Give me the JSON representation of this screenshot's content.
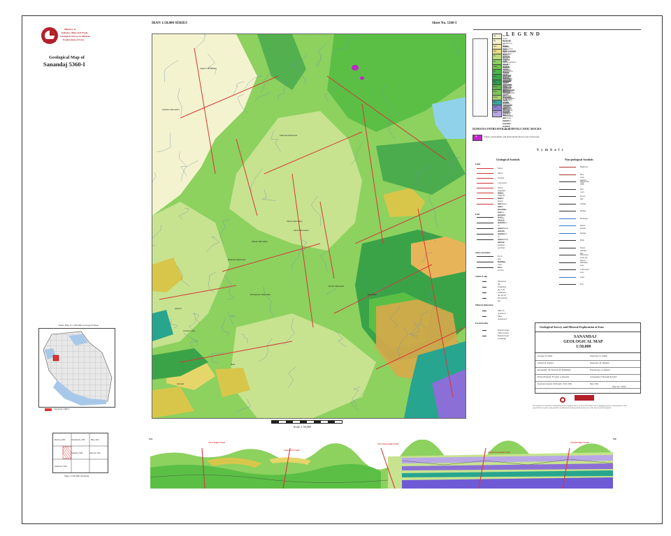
{
  "header": {
    "series": "IRAN 1:50,000 SERIES",
    "sheet_no": "Sheet No. 5360-I"
  },
  "logo": {
    "line1": "Ministry of",
    "line2": "Industry, Mine and Trade",
    "line3": "Geological Survey & Mineral",
    "line4": "Explorations of Iran"
  },
  "map_title": {
    "line1": "Geological Map of",
    "line2": "Sanandaj 5360-I"
  },
  "index_map": {
    "title": "Index Map of 1:250,000 Geological Sheet",
    "legend_label": "Sanandaj 5360-I"
  },
  "sheet_index": {
    "cells": [
      "Marivan_5260",
      "Divandarreh_5360",
      "Bijar_5461",
      "Sanandaj_5360",
      "Kamyaran_5359",
      "Ghorveh_5359"
    ],
    "caption": "Sheet 1:250,000 Sanandaj"
  },
  "scale": {
    "label": "Scale: 1:50,000"
  },
  "legend": {
    "title": "L E G E N D",
    "units": [
      {
        "code": "Qa",
        "color": "#f3f3d8",
        "label": "Recent loose alluvium in braided rivers"
      },
      {
        "code": "Qt",
        "color": "#f5f0c8",
        "label": "Rigid/dip, rounded or slightly transported unconsolidated deposits covering bedrock"
      },
      {
        "code": "Qt2",
        "color": "#f0e8a8",
        "label": "Older and high level terrace"
      },
      {
        "code": "Qt1",
        "color": "#e8dc80",
        "label": "Older and high level river terraces, remnant unconsolidated clastic deposits"
      },
      {
        "code": "Kl",
        "color": "#b9dd7e",
        "label": "Grey to brown well rounded bedded limestone in lower parts and massive fine grain"
      },
      {
        "code": "Ks",
        "color": "#8fd260",
        "label": "Light brown medium to thick bedded sandstone, calcareous sandstone"
      },
      {
        "code": "Ksh",
        "color": "#6ec645",
        "label": "Grey to cream thin to thick bedded limestone, sandy limestone with grey shale"
      },
      {
        "code": "Kv",
        "color": "#4cb84a",
        "label": "Alternation of dark grey thin to medium bedded calcareous sandstone and shale"
      },
      {
        "code": "Kd",
        "color": "#39a848",
        "label": "Greenish grey thin bedded calcareous shale with intercalations of sandy limestone"
      },
      {
        "code": "Kg",
        "color": "#2f9a4a",
        "label": "Greenish grey, dark, calcareous, siltstone with intercalations of conglomerate"
      },
      {
        "code": "Kvs",
        "color": "#5cb54a",
        "label": "Dark green volcanic rocks containing basalt, andesite, volcanic breccia and tuff"
      },
      {
        "code": "Km",
        "color": "#7cc655",
        "label": "Alternation of dark grey thin to medium bedded calcareous shale"
      },
      {
        "code": "Klm",
        "color": "#a6d16d",
        "label": "Dark grey thick bedded calcareous sandstone, siltstone and slate"
      },
      {
        "code": "Kul",
        "color": "#3aa7a0",
        "label": "Lower Cretaceous sandstone (Jurassic to Lower Cretaceous)"
      },
      {
        "code": "TRl",
        "color": "#8a7fd0",
        "label": "Triassic: limestone, sandstone and limestone (dolomite to green marble)"
      },
      {
        "code": "TRd",
        "color": "#b9a8e6",
        "label": "Triassic limestone and marble (dolomite to green marble)"
      }
    ],
    "intrusive_title": "IGNEOUS INTRUSIVE & SUBVOLCANIC ROCKS",
    "intrusive": {
      "code": "gb",
      "color": "#c026c6",
      "label": "Gabbro, monzogabbro and monzodiorite (Post Lower Cretaceous)"
    }
  },
  "symbols": {
    "title": "S y m b o l s",
    "geo_title": "Geological Symbols",
    "nongeo_title": "Non-geological Symbols",
    "geo": [
      {
        "label": "Major",
        "color": "#cc3333"
      },
      {
        "label": "Minor",
        "color": "#cc3333"
      },
      {
        "label": "Normal",
        "color": "#cc3333"
      },
      {
        "label": "Concealed",
        "color": "#cc3333"
      },
      {
        "label": "Strike slip(right lateral)",
        "color": "#cc3333"
      },
      {
        "label": "Strike slip(Left lateral)",
        "color": "#cc3333"
      },
      {
        "label": "Right lateral movement fault (showing in cross section)",
        "color": "#cc3333"
      },
      {
        "label": "Left lateral movement fault (showing in cross section)",
        "color": "#cc3333"
      },
      {
        "label": "Axial trace of anticline",
        "color": "#333333"
      },
      {
        "label": "Axial trace of approximate anticline",
        "color": "#333333"
      },
      {
        "label": "Axial trace of syncline",
        "color": "#333333"
      },
      {
        "label": "Axial trace of approximate syncline",
        "color": "#333333"
      },
      {
        "label": "Axial trace of plunged syncline",
        "color": "#333333"
      },
      {
        "label": "Rock unit boundary",
        "color": "#333333"
      },
      {
        "label": "Bedding form line",
        "color": "#333333"
      },
      {
        "label": "Cross section",
        "color": "#333333"
      },
      {
        "label": "Measured dip",
        "color": "#333333"
      },
      {
        "label": "Estimated dip 5-29",
        "color": "#333333"
      },
      {
        "label": "Estimated dip 30-59",
        "color": "#333333"
      },
      {
        "label": "Overturned dip",
        "color": "#333333"
      },
      {
        "label": "Mine in operation",
        "color": "#333333"
      },
      {
        "label": "Mine abandoned",
        "color": "#333333"
      },
      {
        "label": "Paleontologic (thin section)",
        "color": "#333333"
      },
      {
        "label": "Paleontologic (washing)",
        "color": "#333333"
      }
    ],
    "nongeo": [
      {
        "label": "Highway",
        "color": "#aa3322"
      },
      {
        "label": "First class asphalt road",
        "color": "#aa3322"
      },
      {
        "label": "Motorable road",
        "color": "#333333"
      },
      {
        "label": "Dirt road",
        "color": "#333333"
      },
      {
        "label": "Power line",
        "color": "#333333"
      },
      {
        "label": "Tunnel",
        "color": "#333333"
      },
      {
        "label": "Bridge",
        "color": "#333333"
      },
      {
        "label": "Drainage",
        "color": "#3377cc"
      },
      {
        "label": "Qanat stream",
        "color": "#3377cc"
      },
      {
        "label": "Spring",
        "color": "#3377cc"
      },
      {
        "label": "Dam",
        "color": "#333333"
      },
      {
        "label": "Major summit line",
        "color": "#333333"
      },
      {
        "label": "Elevation point (in meter)",
        "color": "#333333"
      },
      {
        "label": "Building area",
        "color": "#333333"
      },
      {
        "label": "Cultivated area",
        "color": "#333333"
      },
      {
        "label": "Lake",
        "color": "#3377cc"
      },
      {
        "label": "Fan",
        "color": "#333333"
      }
    ],
    "fault_head": "Fault",
    "fold_head": "Fold",
    "other_head": "Other form line",
    "strike_head": "Strike & dip",
    "mineral_head": "Mineral indication",
    "fossil_head": "Fossil locality"
  },
  "title_block": {
    "org": "Geological Survey and Mineral Exploration of Iran",
    "name": "SANANDAJ",
    "kind": "GEOLOGICAL MAP",
    "scale": "1:50,000",
    "rows": [
      [
        "Geology: R. Saheb",
        "Supervisor: A. Ashtari"
      ],
      [
        "Advisers R. Kohzad",
        "Supervisor: M. Ghanbari"
      ],
      [
        "Petrography: Sh. Shaverdi, M. Pashakhani",
        "Paleontology: A. Ahmadi"
      ],
      [
        "RS & GIS Ready: H. Jafari, A. Rayatnia",
        "Cartography: F. Hosseini & Faridi"
      ],
      [
        "Projection System: UTM,GRS , WGS 1984",
        "Date: 2022"
      ]
    ],
    "sheet_ref": "Sheet No.: 5360-I",
    "note": "This map has been produced and published by Geological Survey of Iran in the framework of mapping programs. Reproduction of this map in full or in part is only possible via authorized media permissions from one of the above-mentioned parties."
  },
  "cross_section": {
    "left_label": "SW",
    "right_label": "NE",
    "faults": [
      "West Kalje Fault",
      "Gamarch Fault",
      "West Sanandaj Fault",
      "North Sanandaj Fault",
      "Cheshmidar Fault"
    ]
  },
  "map_labels": [
    "Shahrak Mountain",
    "Zagros Mountain",
    "Shiraz Mountain",
    "Bahman Mountain",
    "Kharkavan Mountain",
    "Dokhan Mountain",
    "Koum Mountain",
    "Masar Mountain",
    "Sareh Mountain",
    "Gosheh Saw",
    "Doulab",
    "Qelyeh",
    "Nasr",
    "Kaniaban"
  ],
  "map_colors": {
    "alluvium": "#f4f3cf",
    "light_green": "#c7e38f",
    "mid_green": "#8dd15f",
    "bright_green": "#5bbf45",
    "dark_green": "#3aa348",
    "yellow": "#d8c64a",
    "teal": "#27a58f",
    "purple": "#8b6fd6",
    "lake": "#8fd2ea",
    "fault": "#d63636"
  }
}
